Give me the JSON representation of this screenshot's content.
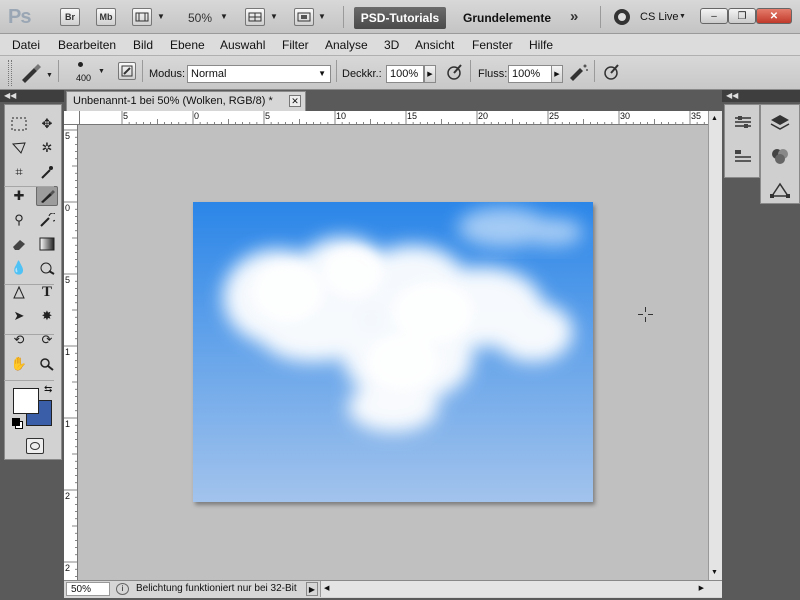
{
  "app": {
    "logo": "Ps",
    "bridge_label": "Br",
    "minibridge_label": "Mb",
    "zoom": "50%",
    "workspace_active": "PSD-Tutorials",
    "workspace_other": "Grundelemente",
    "more": "»",
    "cslive": "CS Live",
    "window_buttons": {
      "minimize": "–",
      "restore": "❐",
      "close": "✕"
    }
  },
  "menu": [
    "Datei",
    "Bearbeiten",
    "Bild",
    "Ebene",
    "Auswahl",
    "Filter",
    "Analyse",
    "3D",
    "Ansicht",
    "Fenster",
    "Hilfe"
  ],
  "options": {
    "brush_size": "400",
    "modus_label": "Modus:",
    "modus_value": "Normal",
    "deckkraft_label": "Deckkr.:",
    "deckkraft_value": "100%",
    "fluss_label": "Fluss:",
    "fluss_value": "100%"
  },
  "document": {
    "tab_title": "Unbenannt-1 bei 50% (Wolken, RGB/8) *",
    "close_glyph": "✕"
  },
  "rulers": {
    "h_labels": [
      "5",
      "0",
      "5",
      "10",
      "15",
      "20",
      "25",
      "30",
      "35"
    ],
    "v_labels": [
      "5",
      "0",
      "5",
      "1",
      "1",
      "2",
      "2"
    ]
  },
  "status": {
    "zoom": "50%",
    "message": "Belichtung funktioniert nur bei 32-Bit"
  },
  "colors": {
    "foreground": "#ffffff",
    "background": "#3a5ea8",
    "sky_top": "#2b86e8",
    "sky_bottom": "#a2c3ec"
  },
  "panel_icons": [
    "adjustments-icon",
    "layers-icon",
    "styles-icon",
    "channels-icon",
    "paths-icon"
  ]
}
